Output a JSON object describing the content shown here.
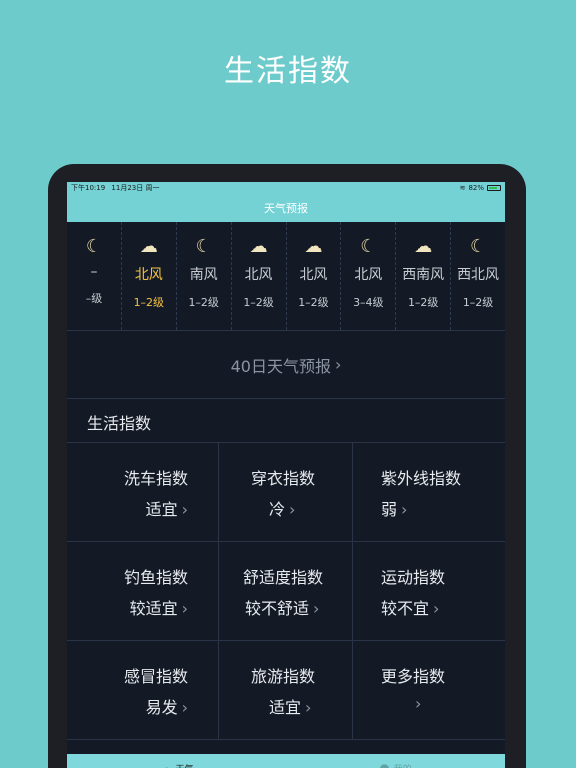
{
  "promo": {
    "title": "生活指数"
  },
  "status_bar": {
    "time": "下午10:19",
    "date": "11月23日 周一",
    "battery": "82%"
  },
  "navbar": {
    "title": "天气预报"
  },
  "forecast": [
    {
      "icon": "moon-icon",
      "direction": "–",
      "level": "–级",
      "active": false
    },
    {
      "icon": "cloud-moon-icon",
      "direction": "北风",
      "level": "1–2级",
      "active": true
    },
    {
      "icon": "moon-icon",
      "direction": "南风",
      "level": "1–2级",
      "active": false
    },
    {
      "icon": "cloud-moon-icon",
      "direction": "北风",
      "level": "1–2级",
      "active": false
    },
    {
      "icon": "cloud-moon-icon",
      "direction": "北风",
      "level": "1–2级",
      "active": false
    },
    {
      "icon": "moon-icon",
      "direction": "北风",
      "level": "3–4级",
      "active": false
    },
    {
      "icon": "cloud-moon-icon",
      "direction": "西南风",
      "level": "1–2级",
      "active": false
    },
    {
      "icon": "moon-icon",
      "direction": "西北风",
      "level": "1–2级",
      "active": false
    }
  ],
  "forty_day": {
    "label": "40日天气预报"
  },
  "life": {
    "title": "生活指数",
    "items": [
      {
        "name": "洗车指数",
        "value": "适宜"
      },
      {
        "name": "穿衣指数",
        "value": "冷"
      },
      {
        "name": "紫外线指数",
        "value": "弱"
      },
      {
        "name": "钓鱼指数",
        "value": "较适宜"
      },
      {
        "name": "舒适度指数",
        "value": "较不舒适"
      },
      {
        "name": "运动指数",
        "value": "较不宜"
      },
      {
        "name": "感冒指数",
        "value": "易发"
      },
      {
        "name": "旅游指数",
        "value": "适宜"
      },
      {
        "name": "更多指数",
        "value": ""
      }
    ]
  },
  "tabs": [
    {
      "label": "天气",
      "icon": "weather-icon",
      "active": true
    },
    {
      "label": "我的",
      "icon": "user-icon",
      "active": false
    }
  ],
  "colors": {
    "background": "#6ecbcc",
    "accent": "#74d2d5",
    "highlight": "#f5c242",
    "screen": "#141a25"
  }
}
